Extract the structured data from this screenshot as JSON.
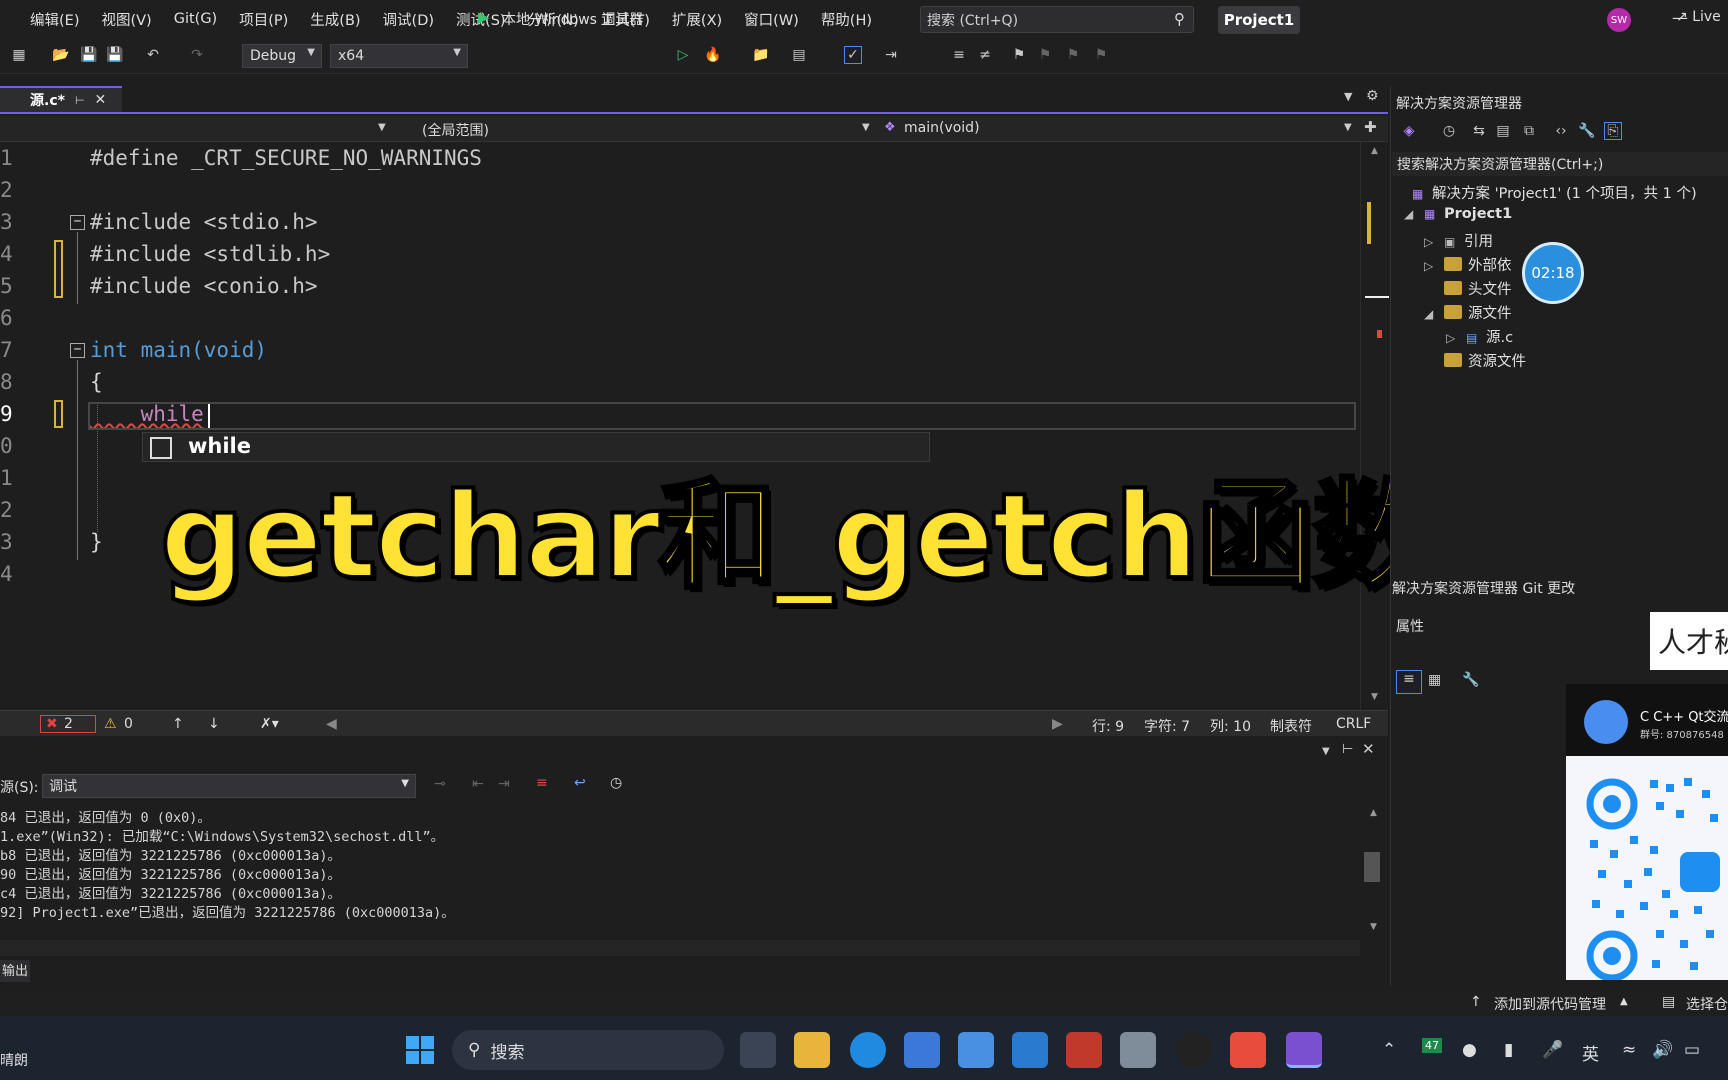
{
  "menu": [
    "编辑(E)",
    "视图(V)",
    "Git(G)",
    "项目(P)",
    "生成(B)",
    "调试(D)",
    "测试(S)",
    "分析(N)",
    "工具(T)",
    "扩展(X)",
    "窗口(W)",
    "帮助(H)"
  ],
  "search": {
    "placeholder": "搜索 (Ctrl+Q)"
  },
  "project_name": "Project1",
  "user_initials": "SW",
  "toolbar": {
    "config": "Debug",
    "platform": "x64",
    "run_label": "本地 Windows 调试器",
    "live_share": "Live"
  },
  "tab": {
    "filename": "源.c*"
  },
  "navbar": {
    "scope": "(全局范围)",
    "function": "main(void)"
  },
  "code_lines": [
    {
      "n": "1",
      "text": "#define _CRT_SECURE_NO_WARNINGS"
    },
    {
      "n": "2",
      "text": ""
    },
    {
      "n": "3",
      "text": "#include <stdio.h>"
    },
    {
      "n": "4",
      "text": "#include <stdlib.h>"
    },
    {
      "n": "5",
      "text": "#include <conio.h>"
    },
    {
      "n": "6",
      "text": ""
    },
    {
      "n": "7",
      "text": "int main(void)"
    },
    {
      "n": "8",
      "text": "{"
    },
    {
      "n": "9",
      "text": "    while"
    },
    {
      "n": "0",
      "text": ""
    },
    {
      "n": "1",
      "text": ""
    },
    {
      "n": "2",
      "text": ""
    },
    {
      "n": "3",
      "text": "}"
    },
    {
      "n": "4",
      "text": ""
    }
  ],
  "intellisense": {
    "suggestion": "while"
  },
  "overlay_title": "getchar和_getch函数",
  "editor_status": {
    "errors": "2",
    "warnings": "0",
    "line": "行: 9",
    "char": "字符: 7",
    "col": "列: 10",
    "tabs": "制表符",
    "eol": "CRLF"
  },
  "output": {
    "source_label": "源(S):",
    "source_value": "调试",
    "lines": [
      "84 已退出，返回值为 0 (0x0)。",
      "1.exe”(Win32): 已加载“C:\\Windows\\System32\\sechost.dll”。",
      "b8 已退出，返回值为 3221225786 (0xc000013a)。",
      "90 已退出，返回值为 3221225786 (0xc000013a)。",
      "c4 已退出，返回值为 3221225786 (0xc000013a)。",
      "92] Project1.exe”已退出，返回值为 3221225786 (0xc000013a)。"
    ],
    "tab_label": "输出"
  },
  "solution_explorer": {
    "title": "解决方案资源管理器",
    "search": "搜索解决方案资源管理器(Ctrl+;)",
    "solution": "解决方案 'Project1' (1 个项目，共 1 个)",
    "project": "Project1",
    "items": [
      "引用",
      "外部依",
      "头文件",
      "源文件",
      "源.c",
      "资源文件"
    ],
    "bottom_tabs": "解决方案资源管理器   Git 更改",
    "timer": "02:18"
  },
  "properties": {
    "title": "属性"
  },
  "talent_popup": "人才秘",
  "qq_card": {
    "name": "C C++ Qt交流",
    "number": "群号: 870876548"
  },
  "ide_status": {
    "add_source": "添加到源代码管理",
    "select": "选择仓"
  },
  "taskbar": {
    "weather": "晴朗",
    "search": "搜索",
    "ime": "英",
    "badge": "47"
  },
  "colors": {
    "accent": "#7160e8",
    "overlay_text": "#ffe234",
    "run_green": "#3bc46b"
  }
}
